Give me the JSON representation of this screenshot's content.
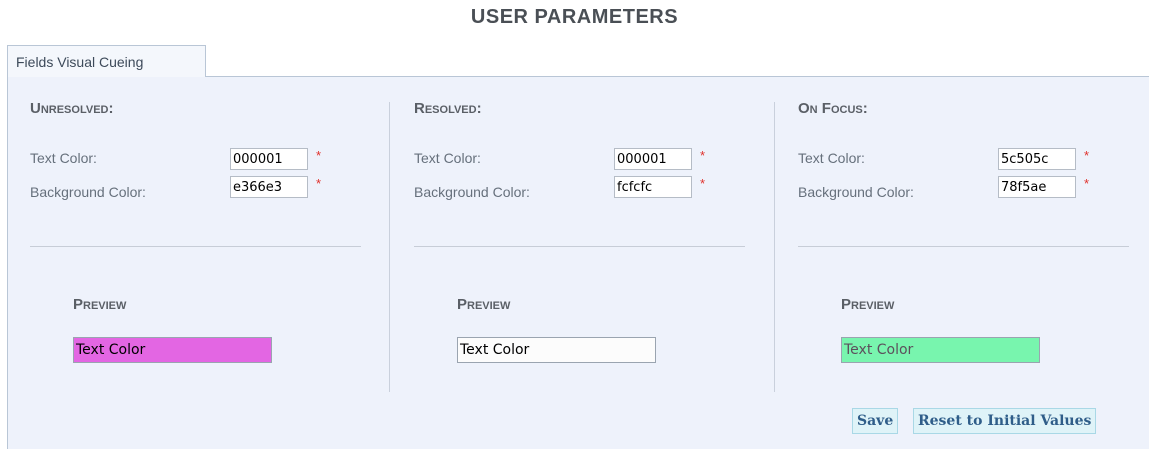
{
  "page": {
    "title": "USER PARAMETERS"
  },
  "tabs": [
    {
      "label": "Fields Visual Cueing"
    }
  ],
  "sections": [
    {
      "heading": "Unresolved:",
      "text_color_label": "Text Color:",
      "text_color_value": "000001",
      "background_color_label": "Background Color:",
      "background_color_value": "e366e3",
      "preview_heading": "Preview",
      "preview_text": "Text Color",
      "preview_text_color": "#000001",
      "preview_background_color": "#e366e3"
    },
    {
      "heading": "Resolved:",
      "text_color_label": "Text Color:",
      "text_color_value": "000001",
      "background_color_label": "Background Color:",
      "background_color_value": "fcfcfc",
      "preview_heading": "Preview",
      "preview_text": "Text Color",
      "preview_text_color": "#000001",
      "preview_background_color": "#fcfcfc"
    },
    {
      "heading": "On Focus:",
      "text_color_label": "Text Color:",
      "text_color_value": "5c505c",
      "background_color_label": "Background Color:",
      "background_color_value": "78f5ae",
      "preview_heading": "Preview",
      "preview_text": "Text Color",
      "preview_text_color": "#5c505c",
      "preview_background_color": "#78f5ae"
    }
  ],
  "required_marker": "*",
  "actions": {
    "save_label": "Save",
    "reset_label": "Reset to Initial Values"
  },
  "colors": {
    "panel_background": "#eef2fb",
    "required_marker": "#e0302a",
    "button_text": "#2f5d89",
    "button_background": "#dff3f8"
  }
}
